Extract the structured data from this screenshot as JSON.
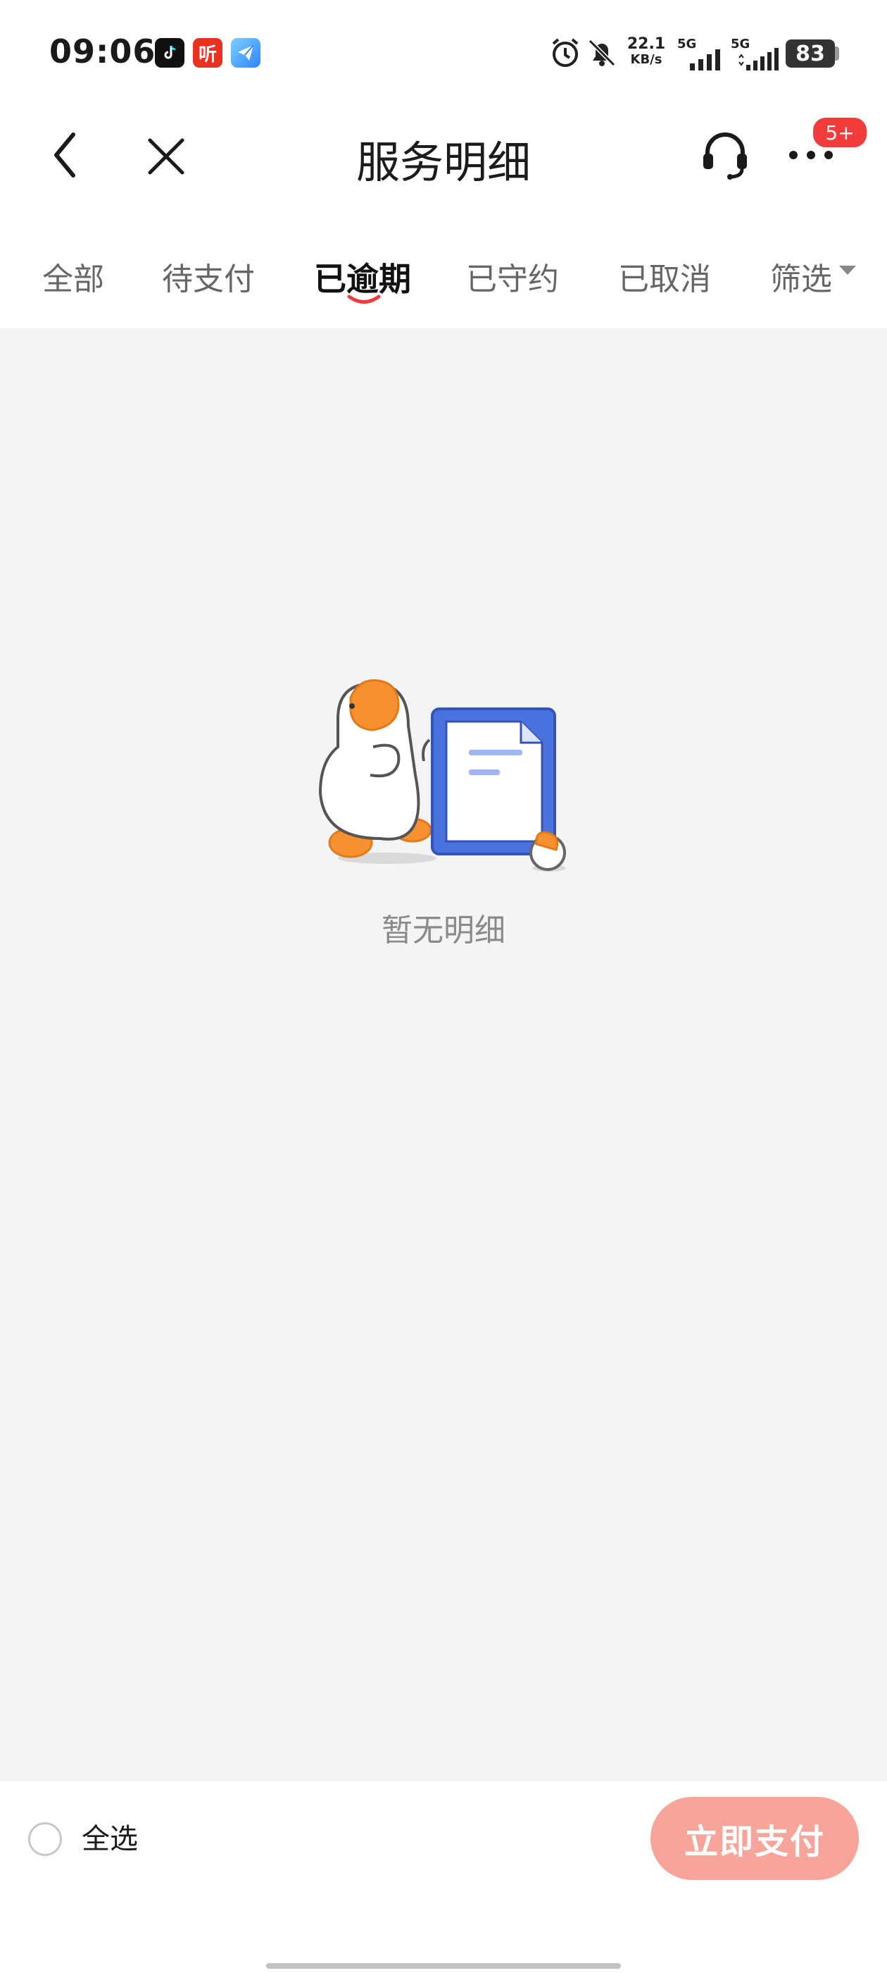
{
  "status_bar": {
    "time": "09:06",
    "net_speed_value": "22.1",
    "net_speed_unit": "KB/s",
    "signal1_label": "5G",
    "signal2_label": "5G",
    "battery": "83",
    "app_icons": [
      "douyin-icon",
      "ting-icon",
      "plane-icon"
    ],
    "ting_glyph": "听"
  },
  "header": {
    "title": "服务明细",
    "more_badge": "5+"
  },
  "tabs": [
    {
      "label": "全部",
      "active": false
    },
    {
      "label": "待支付",
      "active": false
    },
    {
      "label": "已逾期",
      "active": true
    },
    {
      "label": "已守约",
      "active": false
    },
    {
      "label": "已取消",
      "active": false
    },
    {
      "label": "筛选",
      "active": false
    }
  ],
  "empty_state": {
    "message": "暂无明细"
  },
  "footer": {
    "select_all_label": "全选",
    "pay_button_label": "立即支付"
  },
  "colors": {
    "accent": "#f23b3b",
    "pay_button": "#f7a49a",
    "content_bg": "#f3f4f6",
    "illustration_blue": "#4b73e0",
    "illustration_orange": "#f7902e"
  }
}
